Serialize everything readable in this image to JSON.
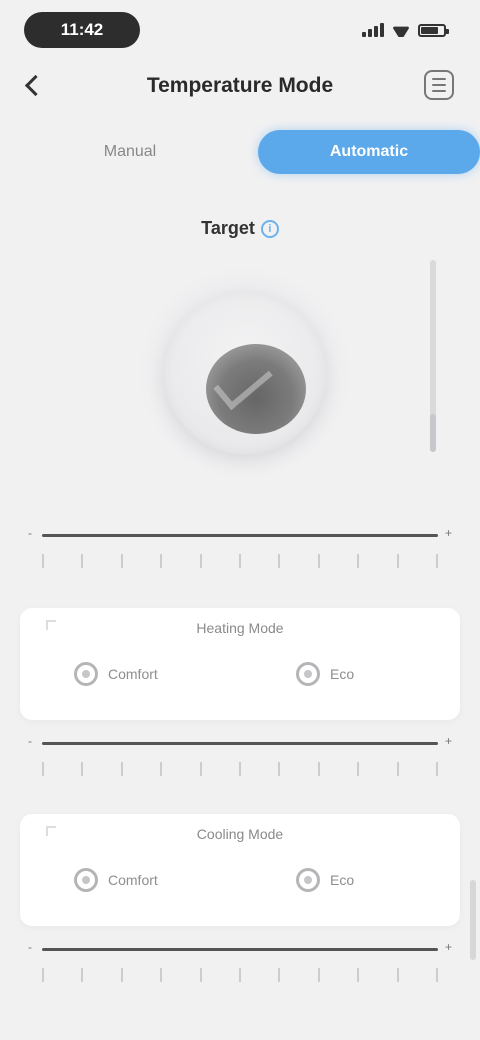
{
  "status_bar": {
    "time": "11:42"
  },
  "nav": {
    "title": "Temperature Mode"
  },
  "segments": {
    "left_label": "Manual",
    "right_label": "Automatic"
  },
  "hint": {
    "label": "Target",
    "info_glyph": "i"
  },
  "dial": {
    "state_icon": "checkmark-icon"
  },
  "slider": {
    "level": 0.2
  },
  "scale_1": {
    "min_label": "-",
    "max_label": "+"
  },
  "card_1": {
    "title": "Heating Mode",
    "option_a": "Comfort",
    "option_b": "Eco"
  },
  "scale_2": {
    "min_label": "-",
    "max_label": "+"
  },
  "card_2": {
    "title": "Cooling Mode",
    "option_a": "Comfort",
    "option_b": "Eco"
  },
  "scale_3": {
    "min_label": "-",
    "max_label": "+"
  },
  "colors": {
    "accent": "#5ba8ea",
    "background": "#f1f1f2",
    "card": "#ffffff"
  }
}
